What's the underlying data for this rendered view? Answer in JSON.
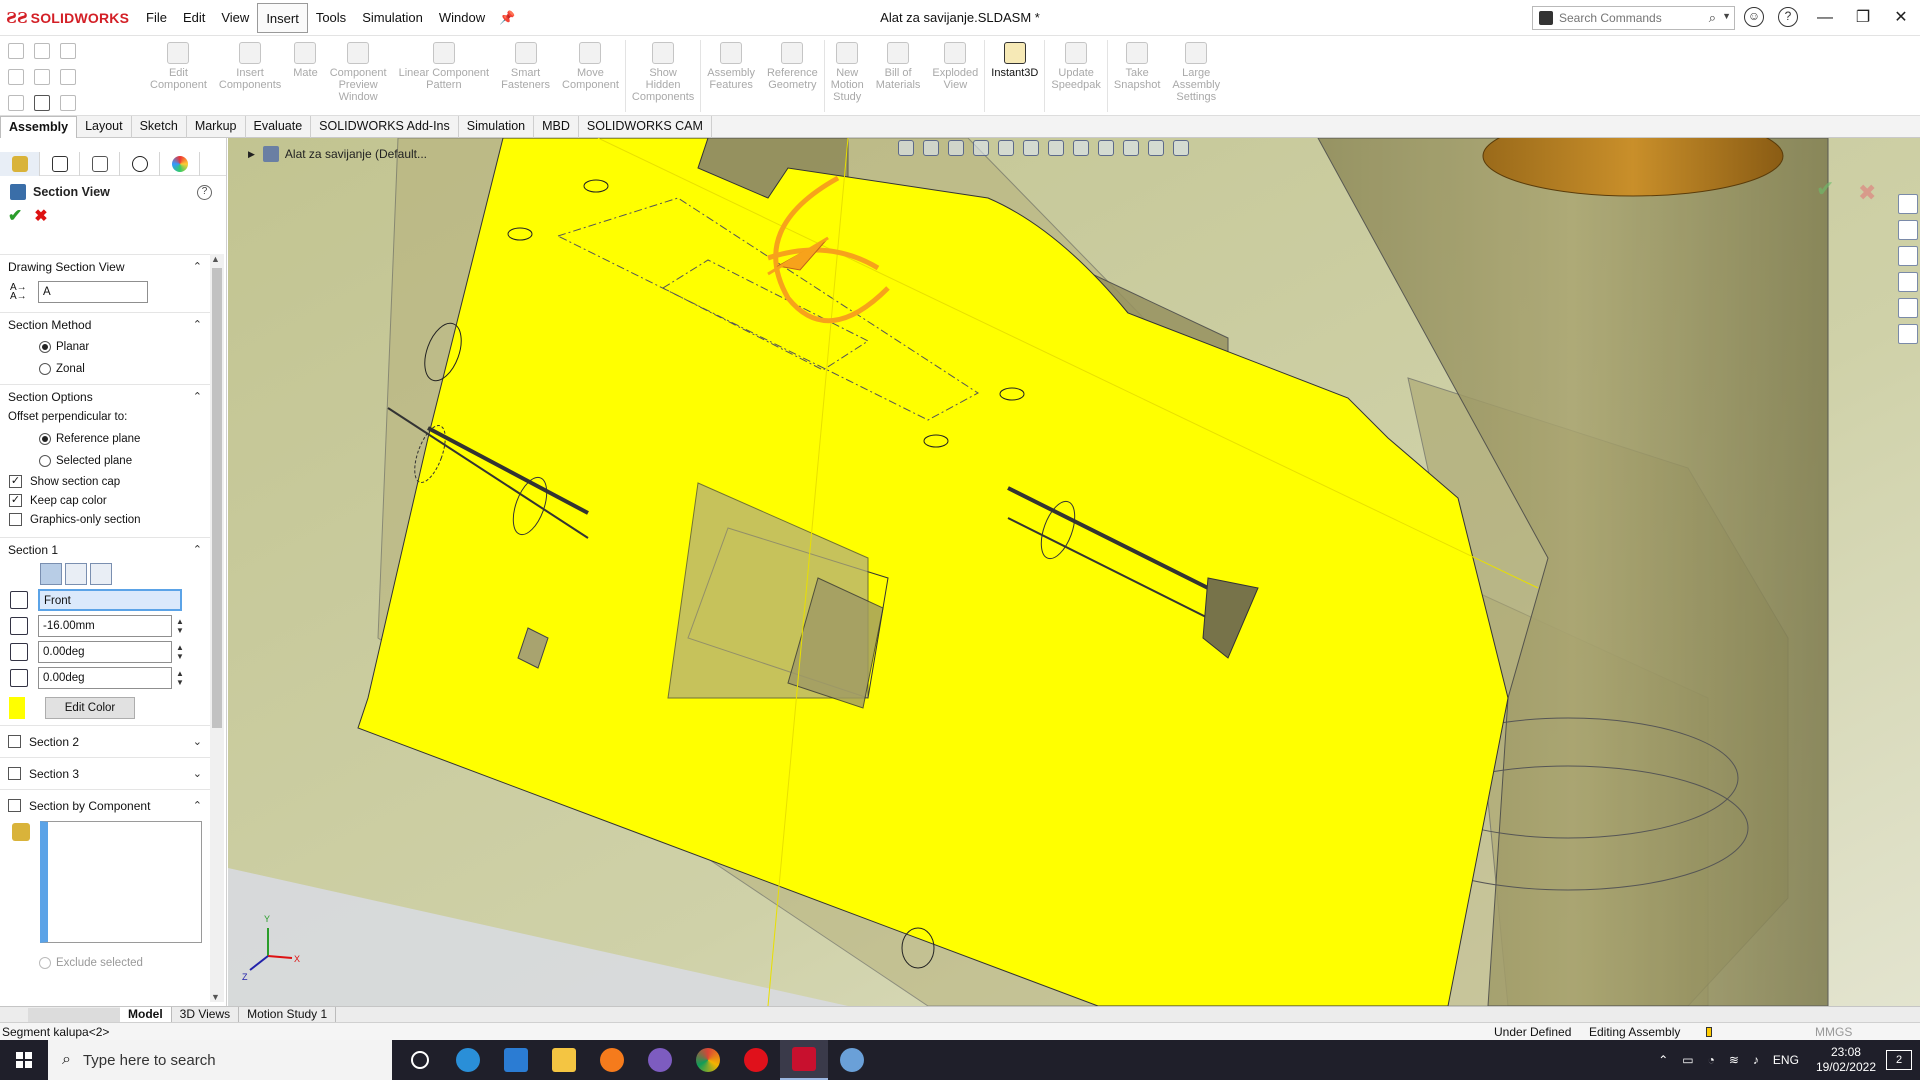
{
  "app": {
    "logo_text": "SOLIDWORKS",
    "document_title": "Alat za savijanje.SLDASM *",
    "menus": [
      "File",
      "Edit",
      "View",
      "Insert",
      "Tools",
      "Simulation",
      "Window"
    ],
    "active_menu": "Insert",
    "search_placeholder": "Search Commands"
  },
  "commands": [
    {
      "label": "Edit\nComponent",
      "enabled": false
    },
    {
      "label": "Insert\nComponents",
      "enabled": false
    },
    {
      "label": "Mate",
      "enabled": false
    },
    {
      "label": "Component\nPreview\nWindow",
      "enabled": false
    },
    {
      "label": "Linear Component\nPattern",
      "enabled": false
    },
    {
      "label": "Smart\nFasteners",
      "enabled": false
    },
    {
      "label": "Move\nComponent",
      "enabled": false
    },
    {
      "label": "Show\nHidden\nComponents",
      "enabled": false
    },
    {
      "label": "Assembly\nFeatures",
      "enabled": false
    },
    {
      "label": "Reference\nGeometry",
      "enabled": false
    },
    {
      "label": "New\nMotion\nStudy",
      "enabled": false
    },
    {
      "label": "Bill of\nMaterials",
      "enabled": false
    },
    {
      "label": "Exploded\nView",
      "enabled": false
    },
    {
      "label": "Instant3D",
      "enabled": true
    },
    {
      "label": "Update\nSpeedpak",
      "enabled": false
    },
    {
      "label": "Take\nSnapshot",
      "enabled": false
    },
    {
      "label": "Large\nAssembly\nSettings",
      "enabled": false
    }
  ],
  "tabs": [
    "Assembly",
    "Layout",
    "Sketch",
    "Markup",
    "Evaluate",
    "SOLIDWORKS Add-Ins",
    "Simulation",
    "MBD",
    "SOLIDWORKS CAM"
  ],
  "active_tab": "Assembly",
  "property_manager": {
    "title": "Section View",
    "drawing_section_view": {
      "title": "Drawing Section View",
      "name_value": "A"
    },
    "section_method": {
      "title": "Section Method",
      "options": [
        "Planar",
        "Zonal"
      ],
      "selected": "Planar"
    },
    "section_options": {
      "title": "Section Options",
      "offset_label": "Offset perpendicular to:",
      "offset_options": [
        "Reference plane",
        "Selected plane"
      ],
      "offset_selected": "Reference plane",
      "checkboxes": [
        {
          "label": "Show section cap",
          "checked": true
        },
        {
          "label": "Keep cap color",
          "checked": true
        },
        {
          "label": "Graphics-only section",
          "checked": false
        }
      ]
    },
    "section1": {
      "title": "Section 1",
      "plane": "Front",
      "offset": "-16.00mm",
      "angle_x": "0.00deg",
      "angle_y": "0.00deg",
      "edit_color_label": "Edit Color",
      "cap_color": "#ffff00"
    },
    "section2": {
      "title": "Section 2",
      "checked": false
    },
    "section3": {
      "title": "Section 3",
      "checked": false
    },
    "section_by_component": {
      "title": "Section by Component",
      "checked": false,
      "exclude_label": "Exclude selected"
    }
  },
  "viewport": {
    "breadcrumb": "Alat za savijanje  (Default..."
  },
  "bottom_tabs": [
    "Model",
    "3D Views",
    "Motion Study 1"
  ],
  "active_bottom_tab": "Model",
  "status": {
    "left": "Segment kalupa<2>",
    "definition": "Under Defined",
    "mode": "Editing Assembly",
    "units": "MMGS"
  },
  "taskbar": {
    "search_text": "Type here to search",
    "language": "ENG",
    "time": "23:08",
    "date": "19/02/2022",
    "notifications": "2"
  },
  "colors": {
    "section_cap": "#ffff00",
    "model_body": "#b3ae7a",
    "background": "#c9cca0",
    "accent_red": "#d31f26"
  }
}
